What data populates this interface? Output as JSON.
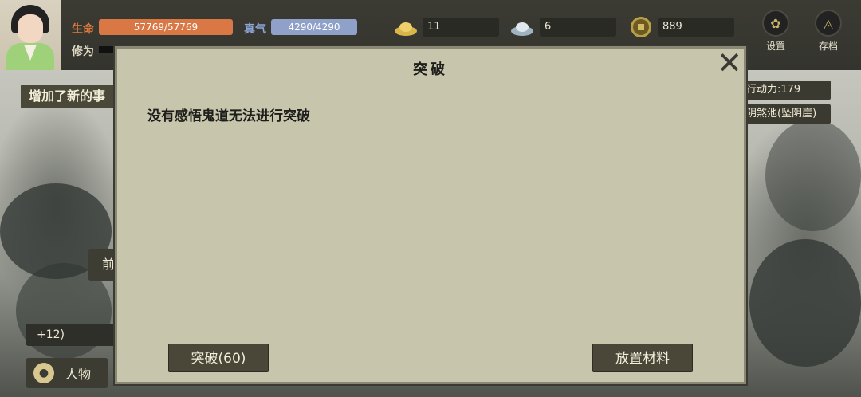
{
  "hud": {
    "hp": {
      "label": "生命",
      "value": "57769/57769",
      "color": "#d97845",
      "label_color": "#e07a3c"
    },
    "qi": {
      "label": "真气",
      "value": "4290/4290",
      "color": "#8fa0c9",
      "label_color": "#8ea6d6"
    },
    "cultivation": {
      "label": "修为",
      "label_color": "#e0d9c2"
    },
    "resources": [
      {
        "icon": "gold-ingot-icon",
        "value": "11"
      },
      {
        "icon": "silver-ingot-icon",
        "value": "6"
      },
      {
        "icon": "copper-coin-icon",
        "value": "889"
      }
    ],
    "settings_label": "设置",
    "save_label": "存档"
  },
  "background_ui": {
    "event_banner": "增加了新的事",
    "action_points": "行动力:179",
    "location": "阴煞池(坠阴崖)",
    "left_tab": "前",
    "left_chip": "+12)",
    "character_button": "人物"
  },
  "dialog": {
    "title": "突破",
    "message": "没有感悟鬼道无法进行突破",
    "breakthrough_button": "突破(60)",
    "place_materials_button": "放置材料",
    "close_glyph": "✕"
  }
}
